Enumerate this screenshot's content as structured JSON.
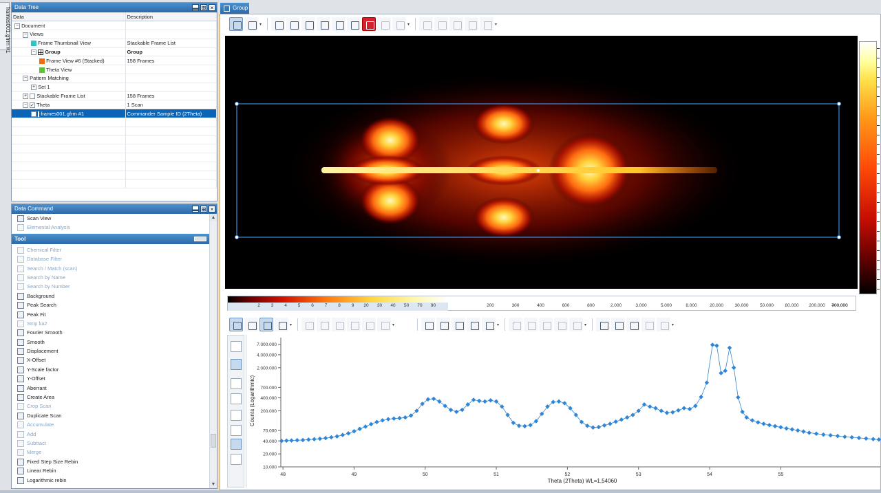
{
  "side_tab": "frames001.gfrm #1",
  "data_tree": {
    "title": "Data Tree",
    "columns": [
      "Data",
      "Description"
    ],
    "rows": [
      {
        "indent": 0,
        "toggle": "−",
        "check": "",
        "swatch": "",
        "label": "Document",
        "desc": "",
        "bold": false,
        "selected": false
      },
      {
        "indent": 1,
        "toggle": "−",
        "check": "",
        "swatch": "",
        "label": "Views",
        "desc": "",
        "bold": false,
        "selected": false
      },
      {
        "indent": 2,
        "toggle": "",
        "check": "",
        "swatch": "#2cc6c6",
        "label": "Frame Thumbnail View",
        "desc": "Stackable Frame List",
        "bold": false,
        "selected": false
      },
      {
        "indent": 2,
        "toggle": "−",
        "check": "",
        "swatch": "grid",
        "label": "Group",
        "desc": "Group",
        "bold": true,
        "selected": false
      },
      {
        "indent": 3,
        "toggle": "",
        "check": "",
        "swatch": "#f06a0f",
        "label": "Frame View #6 (Stacked)",
        "desc": "158 Frames",
        "bold": false,
        "selected": false
      },
      {
        "indent": 3,
        "toggle": "",
        "check": "",
        "swatch": "#5cc234",
        "label": "Theta View",
        "desc": "",
        "bold": false,
        "selected": false
      },
      {
        "indent": 1,
        "toggle": "−",
        "check": "",
        "swatch": "",
        "label": "Pattern Matching",
        "desc": "",
        "bold": false,
        "selected": false
      },
      {
        "indent": 2,
        "toggle": "+",
        "check": "",
        "swatch": "",
        "label": "Set 1",
        "desc": "",
        "bold": false,
        "selected": false
      },
      {
        "indent": 1,
        "toggle": "+",
        "check": "□",
        "swatch": "",
        "label": "Stackable Frame List",
        "desc": "158 Frames",
        "bold": false,
        "selected": false
      },
      {
        "indent": 1,
        "toggle": "−",
        "check": "✓",
        "swatch": "",
        "label": "Theta",
        "desc": "1 Scan",
        "bold": false,
        "selected": false
      },
      {
        "indent": 2,
        "toggle": "",
        "check": "✓",
        "swatch": "|",
        "label": "frames001.gfrm #1",
        "desc": "Commander Sample ID (2Theta)",
        "bold": false,
        "selected": true
      }
    ]
  },
  "data_command": {
    "title": "Data Command",
    "top_items": [
      {
        "label": "Scan View",
        "disabled": false
      },
      {
        "label": "Elemental Analysis",
        "disabled": true
      }
    ],
    "tool_header": "Tool",
    "tools": [
      {
        "label": "Chemical Filter",
        "disabled": true
      },
      {
        "label": "Database Filter",
        "disabled": true
      },
      {
        "label": "Search / Match (scan)",
        "disabled": true
      },
      {
        "label": "Search by Name",
        "disabled": true
      },
      {
        "label": "Search by Number",
        "disabled": true
      },
      {
        "label": "Background",
        "disabled": false
      },
      {
        "label": "Peak Search",
        "disabled": false
      },
      {
        "label": "Peak Fit",
        "disabled": false
      },
      {
        "label": "Strip ka2",
        "disabled": true
      },
      {
        "label": "Fourier Smooth",
        "disabled": false
      },
      {
        "label": "Smooth",
        "disabled": false
      },
      {
        "label": "Displacement",
        "disabled": false
      },
      {
        "label": "X-Offset",
        "disabled": false
      },
      {
        "label": "Y-Scale factor",
        "disabled": false
      },
      {
        "label": "Y-Offset",
        "disabled": false
      },
      {
        "label": "Aberrant",
        "disabled": false
      },
      {
        "label": "Create Area",
        "disabled": false
      },
      {
        "label": "Crop Scan",
        "disabled": true
      },
      {
        "label": "Duplicate Scan",
        "disabled": false
      },
      {
        "label": "Accumulate",
        "disabled": true
      },
      {
        "label": "Add",
        "disabled": true
      },
      {
        "label": "Subtract",
        "disabled": true
      },
      {
        "label": "Merge",
        "disabled": true
      },
      {
        "label": "Fixed Step Size Rebin",
        "disabled": false
      },
      {
        "label": "Linear Rebin",
        "disabled": false
      },
      {
        "label": "Logarithmic rebin",
        "disabled": false
      }
    ]
  },
  "doc_tab": "Group",
  "intensity_scale_labels": [
    "2",
    "3",
    "4",
    "5",
    "6",
    "7",
    "8",
    "9",
    "20",
    "30",
    "40",
    "50",
    "70",
    "90",
    "200",
    "300",
    "400",
    "600",
    "800",
    "2.000",
    "3.000",
    "5.000",
    "8.000",
    "20.000",
    "30.000",
    "50.000",
    "80.000",
    "200.000",
    "400.000",
    "700.000"
  ],
  "chart_data": {
    "type": "scatter",
    "xlabel": "Theta (2Theta) WL=1,54060",
    "ylabel": "Counts (Logarithmic)",
    "xlim": [
      47.97,
      56.4
    ],
    "ylim": [
      10000,
      10000000
    ],
    "yscale": "log",
    "xticks": [
      48,
      49,
      50,
      51,
      52,
      53,
      54,
      55
    ],
    "xtick_labels": [
      "48",
      "49",
      "50",
      "51",
      "52",
      "53",
      "54",
      "55"
    ],
    "yticks": [
      10000,
      20000,
      40000,
      70000,
      200000,
      400000,
      700000,
      2000000,
      4000000,
      7000000
    ],
    "ytick_labels": [
      "10.000",
      "20.000",
      "40.000",
      "70.000",
      "200.000",
      "400.000",
      "700.000",
      "2.000.000",
      "4.000.000",
      "7.000.000"
    ],
    "marker_color": "#2f86d6",
    "series": [
      {
        "x": [
          47.98,
          48.05,
          48.12,
          48.2,
          48.28,
          48.36,
          48.44,
          48.52,
          48.6,
          48.68,
          48.76,
          48.84,
          48.92,
          49.0,
          49.08,
          49.16,
          49.24,
          49.32,
          49.4,
          49.48,
          49.56,
          49.64,
          49.72,
          49.8,
          49.88,
          49.96,
          50.04,
          50.12,
          50.2,
          50.28,
          50.36,
          50.44,
          50.52,
          50.6,
          50.68,
          50.76,
          50.84,
          50.92,
          51.0,
          51.08,
          51.16,
          51.24,
          51.32,
          51.4,
          51.48,
          51.56,
          51.64,
          51.72,
          51.8,
          51.88,
          51.96,
          52.04,
          52.12,
          52.2,
          52.28,
          52.36,
          52.44,
          52.52,
          52.6,
          52.68,
          52.76,
          52.84,
          52.92,
          53.0,
          53.08,
          53.16,
          53.24,
          53.32,
          53.4,
          53.48,
          53.56,
          53.64,
          53.72,
          53.8,
          53.88,
          53.96,
          54.04,
          54.1,
          54.16,
          54.22,
          54.28,
          54.34,
          54.4,
          54.46,
          54.52,
          54.6,
          54.68,
          54.76,
          54.84,
          54.92,
          55.0,
          55.08,
          55.16,
          55.24,
          55.32,
          55.4,
          55.5,
          55.6,
          55.7,
          55.8,
          55.9,
          56.0,
          56.1,
          56.2,
          56.3,
          56.38
        ],
        "y": [
          40000,
          40500,
          41000,
          41500,
          42000,
          42800,
          43800,
          45000,
          46500,
          48500,
          51000,
          55000,
          60000,
          67000,
          76000,
          86000,
          98000,
          110000,
          120000,
          128000,
          132000,
          135000,
          140000,
          155000,
          200000,
          290000,
          370000,
          380000,
          330000,
          260000,
          210000,
          190000,
          210000,
          280000,
          360000,
          340000,
          330000,
          350000,
          330000,
          250000,
          160000,
          105000,
          90000,
          88000,
          93000,
          115000,
          170000,
          250000,
          320000,
          330000,
          300000,
          230000,
          160000,
          110000,
          90000,
          82000,
          84000,
          92000,
          100000,
          112000,
          125000,
          140000,
          160000,
          200000,
          280000,
          250000,
          230000,
          200000,
          180000,
          185000,
          205000,
          230000,
          220000,
          260000,
          420000,
          900000,
          6800000,
          6500000,
          1500000,
          1700000,
          5800000,
          2000000,
          410000,
          190000,
          140000,
          120000,
          108000,
          100000,
          93000,
          88000,
          83000,
          78000,
          74000,
          70000,
          66000,
          62000,
          59000,
          56000,
          54000,
          52000,
          50000,
          48500,
          47000,
          45500,
          44000,
          43000
        ]
      }
    ]
  }
}
